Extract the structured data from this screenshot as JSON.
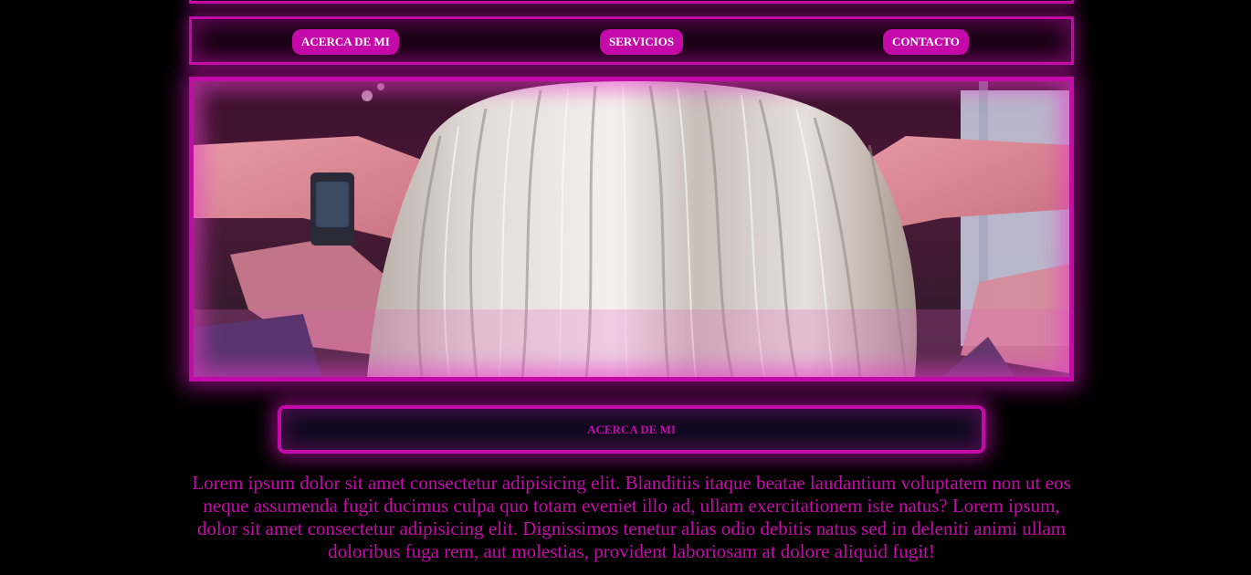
{
  "nav": {
    "items": [
      {
        "label": "ACERCA DE MI"
      },
      {
        "label": "SERVICIOS"
      },
      {
        "label": "CONTACTO"
      }
    ]
  },
  "hero": {
    "image": "blonde-hair-photo"
  },
  "about": {
    "title": "ACERCA DE MI",
    "text": "Lorem ipsum dolor sit amet consectetur adipisicing elit. Blanditiis itaque beatae laudantium voluptatem non ut eos neque assumenda fugit ducimus culpa quo totam eveniet illo ad, ullam exercitationem iste natus? Lorem ipsum, dolor sit amet consectetur adipisicing elit. Dignissimos tenetur alias odio debitis natus sed in deleniti animi ullam doloribus fuga rem, aut molestias, provident laboriosam at dolore aliquid fugit!"
  },
  "colors": {
    "accent": "#c40aa8",
    "background": "#000000",
    "button_text": "#ffffff"
  }
}
